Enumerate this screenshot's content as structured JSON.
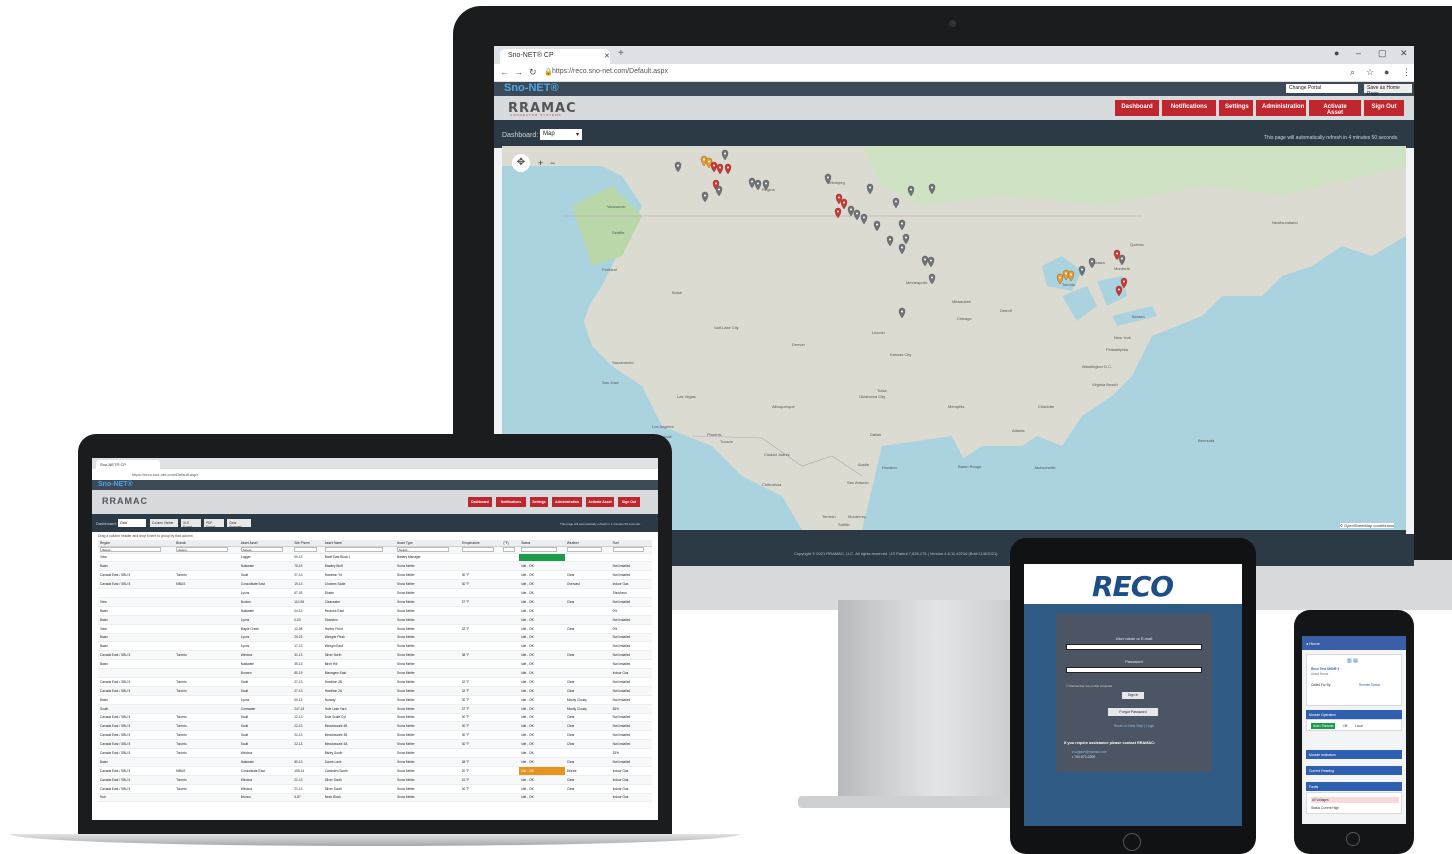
{
  "monitor": {
    "browser": {
      "tab_title": "Sno-NET® CP",
      "url": "https://reco.sno-net.com/Default.aspx"
    },
    "app": {
      "brand": "Sno-NET®",
      "logo": "RRAMAC",
      "logo_sub": "CONNECTOR SYSTEMS",
      "portal_select": "Change Portal",
      "home_button": "Save as Home Page",
      "nav": [
        "Dashboard",
        "Notifications",
        "Settings",
        "Administration",
        "Activate Asset",
        "Sign Out"
      ],
      "dashboard_label": "Dashboard:",
      "dashboard_value": "Map",
      "refresh_message": "This page will automatically refresh in 4 minutes 50 seconds.",
      "map_attribution": "© OpenStreetMap contributors",
      "copyright": "Copyright © 2021 RRAMAC, LLC. All rights reserved. US Patent 7,826,175 | Version 4.6.11.42216 (Built 11/8/2021)"
    },
    "map_places": [
      "Vancouver",
      "Seattle",
      "Portland",
      "Boise",
      "Salt Lake City",
      "Sacramento",
      "San Jose",
      "Las Vegas",
      "Los Angeles",
      "Phoenix",
      "Tucson",
      "Mexicali",
      "Ciudad Juárez",
      "Denver",
      "Albuquerque",
      "Dallas",
      "Houston",
      "San Antonio",
      "Austin",
      "Oklahoma City",
      "Tulsa",
      "Kansas City",
      "Lincoln",
      "Minneapolis",
      "Winnipeg",
      "Regina",
      "Milwaukee",
      "Chicago",
      "Detroit",
      "Toronto",
      "Ottawa",
      "Montreal",
      "Québec",
      "Boston",
      "New York",
      "Philadelphia",
      "Washington D.C.",
      "Virginia Beach",
      "Charlotte",
      "Atlanta",
      "Memphis",
      "Jacksonville",
      "Baton Rouge",
      "Newfoundland",
      "Bermuda",
      "Monterrey",
      "Torreón",
      "Saltillo",
      "Chihuahua"
    ],
    "colors": {
      "pin_gray": "#6f7377",
      "pin_red": "#d1342f",
      "pin_orange": "#eb9b2d",
      "navbtn": "#c0262d",
      "brand": "#4ea6e6"
    }
  },
  "laptop": {
    "tab_title": "Sno-NET® CP",
    "url": "https://reco.sno-net.com/Default.aspx",
    "brand": "Sno-NET®",
    "logo": "RRAMAC",
    "nav": [
      "Dashboard",
      "Notifications",
      "Settings",
      "Administration",
      "Activate Asset",
      "Sign Out"
    ],
    "dashboard_label": "Dashboard:",
    "dashboard_value": "Grid",
    "tool_buttons": [
      "Column Visible",
      "XLS Export",
      "PDF Export",
      "Clear Grouped"
    ],
    "refresh_message": "This page will automatically refresh in 1 minutes 58 seconds.",
    "grid_hint": "Drag a column header and drop it here to group by that column",
    "columns": [
      "Region",
      "Branch",
      "Asset Asset",
      "Site Phone",
      "Asset Name",
      "Asset Type",
      "Temperature",
      "(°F)",
      "Status",
      "Weather",
      "Fuel"
    ],
    "filter_values": [
      "-Select-",
      "-Select-",
      "-Select-",
      "",
      "",
      "-Select-",
      "",
      "",
      "",
      "",
      ""
    ],
    "rows": [
      [
        "View",
        "",
        "Logger",
        "00-13",
        "Banff East Block 1",
        "Battery Manager",
        "",
        "",
        "",
        "",
        ""
      ],
      [
        "Basin",
        "",
        "Nakiwate",
        "75-19",
        "Bradley Bluff",
        "Snow Melter",
        "",
        "",
        "Idle - OK",
        "",
        "Not Installed"
      ],
      [
        "Canada East / SBU 5",
        "Toronto",
        "Sault",
        "27-13",
        "Hamilton Yd",
        "Snow Melter",
        "30 °F",
        "",
        "Idle - OK",
        "Clear",
        "Not Installed"
      ],
      [
        "Canada East / SBU 5",
        "MBUS",
        "Consolidate East",
        "19-13",
        "Chomes Scale",
        "Snow Melter",
        "30 °F",
        "",
        "Idle - OK",
        "Overcast",
        "Indoor Gas"
      ],
      [
        "",
        "",
        "Lyons",
        "67-03",
        "Dhaim",
        "Snow Melter",
        "",
        "",
        "Idle - OK",
        "",
        "Shutdown"
      ],
      [
        "View",
        "",
        "Bunton",
        "110-98",
        "Clearwater",
        "Snow Melter",
        "37 °F",
        "",
        "Idle - OK",
        "Clear",
        "Not Installed"
      ],
      [
        "Basin",
        "",
        "Nakiwate",
        "04-13",
        "Redrock East",
        "Snow Melter",
        "",
        "",
        "Idle - OK",
        "",
        "0%"
      ],
      [
        "Basin",
        "",
        "Lyons",
        "0-03",
        "Stranden",
        "Snow Melter",
        "",
        "",
        "Idle - OK",
        "",
        "Not Installed"
      ],
      [
        "View",
        "",
        "Maple Creek",
        "12-08",
        "Harbor Point",
        "Snow Melter",
        "32 °F",
        "",
        "Idle - OK",
        "Clear",
        "0%"
      ],
      [
        "Basin",
        "",
        "Lyons",
        "25-23",
        "Weegier Peak",
        "Snow Melter",
        "",
        "",
        "Idle - OK",
        "",
        "Not Installed"
      ],
      [
        "Basin",
        "",
        "Lyons",
        "17-13",
        "Weegin East",
        "Snow Melter",
        "",
        "",
        "Idle - OK",
        "",
        "Not Installed"
      ],
      [
        "Canada East / SBU 5",
        "Toronto",
        "Windsor",
        "31-13",
        "Silver North",
        "Snow Melter",
        "38 °F",
        "",
        "Idle - OK",
        "Clear",
        "Not Installed"
      ],
      [
        "Basin",
        "",
        "Nakiwate",
        "35-13",
        "Birch Hill",
        "Snow Melter",
        "",
        "",
        "Idle - OK",
        "",
        "Not Installed"
      ],
      [
        "",
        "",
        "Bunzen",
        "80-19",
        "Managem East",
        "Snow Melter",
        "",
        "",
        "Idle - OK",
        "",
        "Indoor Gas"
      ],
      [
        "Canada East / SBU 5",
        "Toronto",
        "Sault",
        "27-13",
        "Hamilton 2B",
        "Snow Melter",
        "32 °F",
        "",
        "Idle - OK",
        "Clear",
        "Not Installed"
      ],
      [
        "Canada East / SBU 5",
        "Toronto",
        "Sault",
        "27-13",
        "Hamilton 2A",
        "Snow Melter",
        "32 °F",
        "",
        "Idle - OK",
        "Clear",
        "Not Installed"
      ],
      [
        "Basin",
        "",
        "Lyons",
        "00-13",
        "Norway",
        "Snow Melter",
        "30 °F",
        "",
        "Idle - OK",
        "Mostly Cloudy",
        "Not Installed"
      ],
      [
        "South",
        "",
        "Cornwater",
        "247-15",
        "Hole Lake Yard",
        "Snow Melter",
        "37 °F",
        "",
        "Idle - OK",
        "Mostly Cloudy",
        "65%"
      ],
      [
        "Canada East / SBU 5",
        "Toronto",
        "Sault",
        "12-13",
        "Dole Scale Cyt",
        "Snow Melter",
        "30 °F",
        "",
        "Idle - OK",
        "Clear",
        "Not Installed"
      ],
      [
        "Canada East / SBU 5",
        "Toronto",
        "Sault",
        "22-13",
        "Meadowvale 4B",
        "Snow Melter",
        "30 °F",
        "",
        "Idle - OK",
        "Clear",
        "Not Installed"
      ],
      [
        "Canada East / SBU 5",
        "Toronto",
        "Sault",
        "22-13",
        "Meadowvale 3B",
        "Snow Melter",
        "30 °F",
        "",
        "Idle - OK",
        "Clear",
        "Not Installed"
      ],
      [
        "Canada East / SBU 5",
        "Toronto",
        "Sault",
        "22-13",
        "Meadowvale 3A",
        "Snow Melter",
        "30 °F",
        "",
        "Idle - OK",
        "Clear",
        "Not Installed"
      ],
      [
        "Canada East / SBU 5",
        "Toronto",
        "Windsor",
        "",
        "Bisley South",
        "Snow Melter",
        "",
        "",
        "Idle - OK",
        "",
        "33%"
      ],
      [
        "Basin",
        "",
        "Nakiwate",
        "80-13",
        "Zones Lane",
        "Snow Melter",
        "38 °F",
        "",
        "Idle - OK",
        "Clear",
        "Not Installed"
      ],
      [
        "Canada East / SBU 5",
        "MBUS",
        "Consolidate East",
        "195-14",
        "Cambden South",
        "Snow Melter",
        "20 °F",
        "",
        "Idle - OK",
        "Drizzle",
        "Indoor Gas"
      ],
      [
        "Canada East / SBU 5",
        "Toronto",
        "Windsor",
        "21-13",
        "Silver South",
        "Snow Melter",
        "31 °F",
        "",
        "Idle - OK",
        "Clear",
        "Indoor Gas"
      ],
      [
        "Canada East / SBU 5",
        "Toronto",
        "Windsor",
        "21-13",
        "Silver South",
        "Snow Melter",
        "30 °F",
        "",
        "Idle - OK",
        "Clear",
        "Indoor Gas"
      ],
      [
        "Hub",
        "",
        "Bronco",
        "5-87",
        "Nesh Block",
        "Snow Melter",
        "",
        "",
        "Idle - OK",
        "",
        "Indoor Gas"
      ]
    ]
  },
  "tablet": {
    "logo": "RECO",
    "username_label": "User name or E-mail",
    "password_label": "Password",
    "remember_label": "Remember me on this computer",
    "sign_in": "Sign In",
    "forgot_password": "Forgot Password",
    "link": "Reset on Next Step  |  Login",
    "help_text": "If you require assistance please contact RRAMAC:",
    "contact_email": "support@rramac.com",
    "contact_phone": "740-872-2200"
  },
  "phone": {
    "header": "Home",
    "asset_title": "Reco Test SHINE 3",
    "asset_sub": "Asset Name",
    "sections": [
      "Module Operation",
      "Module Indicators",
      "Current Reading",
      "Faults"
    ],
    "on_button": "Auto / Remote",
    "off_label": "Off",
    "local_label": "Local",
    "status_left": "Called For By:",
    "status_right": "Remote Status",
    "fault_1": "All Voltages",
    "fault_2": "Status Current High"
  }
}
